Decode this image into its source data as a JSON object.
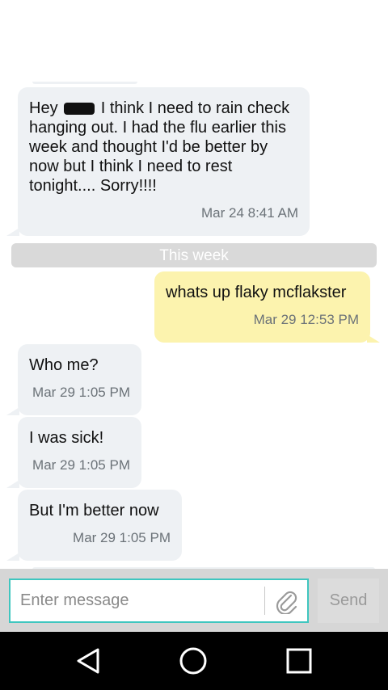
{
  "messages": [
    {
      "direction": "in",
      "text_start": "Hey",
      "text_rest": "I think I need to rain check hanging out. I had the flu earlier this week and thought I'd be better by now but I think I need to rest tonight.... Sorry!!!!",
      "time": "Mar 24 8:41 AM",
      "redacted_name": true
    },
    {
      "direction": "out",
      "text": "whats up flaky mcflakster",
      "time": "Mar 29 12:53 PM"
    },
    {
      "direction": "in",
      "text": "Who me?",
      "time": "Mar 29 1:05 PM"
    },
    {
      "direction": "in",
      "text": "I was sick!",
      "time": "Mar 29 1:05 PM"
    },
    {
      "direction": "in",
      "text": "But I'm better now",
      "time": "Mar 29 1:05 PM"
    }
  ],
  "divider": {
    "label": "This week"
  },
  "composer": {
    "placeholder": "Enter message",
    "value": "",
    "send_label": "Send",
    "attach_icon": "paperclip-icon"
  },
  "navbar": {
    "back_icon": "back-triangle-icon",
    "home_icon": "home-circle-icon",
    "recents_icon": "recents-square-icon"
  },
  "colors": {
    "incoming_bubble": "#eef1f4",
    "outgoing_bubble": "#fcf3ae",
    "input_border": "#3fc6bf",
    "divider": "#d9d9d9"
  }
}
